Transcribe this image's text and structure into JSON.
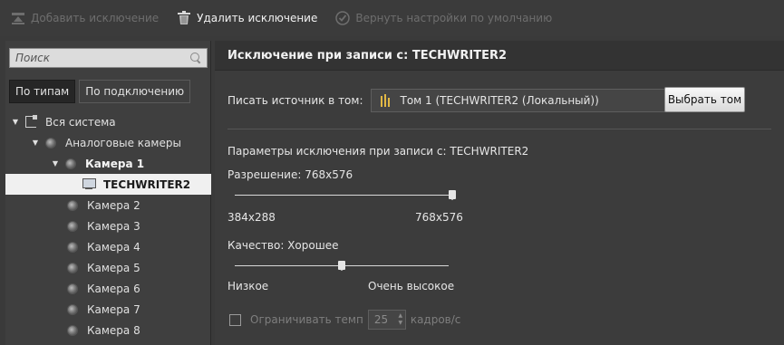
{
  "toolbar": {
    "add_label": "Добавить исключение",
    "delete_label": "Удалить исключение",
    "reset_label": "Вернуть настройки по умолчанию"
  },
  "left": {
    "search_placeholder": "Поиск",
    "tabs": [
      {
        "label": "По типам",
        "active": true
      },
      {
        "label": "По подключению",
        "active": false
      }
    ],
    "tree": [
      {
        "label": "Вся система",
        "icon": "system-icon",
        "level": 0,
        "expanded": true
      },
      {
        "label": "Аналоговые камеры",
        "icon": "camera-icon",
        "level": 1,
        "expanded": true
      },
      {
        "label": "Камера 1",
        "icon": "camera-icon",
        "level": 2,
        "expanded": true,
        "bold": true
      },
      {
        "label": "TECHWRITER2",
        "icon": "computer-icon",
        "level": 3,
        "selected": true
      },
      {
        "label": "Камера 2",
        "icon": "camera-icon",
        "level": 2
      },
      {
        "label": "Камера 3",
        "icon": "camera-icon",
        "level": 2
      },
      {
        "label": "Камера 4",
        "icon": "camera-icon",
        "level": 2
      },
      {
        "label": "Камера 5",
        "icon": "camera-icon",
        "level": 2
      },
      {
        "label": "Камера 6",
        "icon": "camera-icon",
        "level": 2
      },
      {
        "label": "Камера 7",
        "icon": "camera-icon",
        "level": 2
      },
      {
        "label": "Камера 8",
        "icon": "camera-icon",
        "level": 2
      }
    ]
  },
  "right": {
    "header": "Исключение при записи с: TECHWRITER2",
    "write_label": "Писать источник в том:",
    "volume_value": "Том 1 (TECHWRITER2 (Локальный))",
    "choose_button": "Выбрать том",
    "params_title": "Параметры исключения при записи с: TECHWRITER2",
    "resolution": {
      "label": "Разрешение: 768x576",
      "min_label": "384x288",
      "max_label": "768x576",
      "value_fraction": 1.0
    },
    "quality": {
      "label": "Качество: Хорошее",
      "min_label": "Низкое",
      "max_label": "Очень высокое",
      "value_fraction": 0.5
    },
    "limit": {
      "label": "Ограничивать темп",
      "checked": false,
      "value": "25",
      "unit": "кадров/с"
    }
  },
  "colors": {
    "background": "#3a3a3a",
    "selected_row": "#f0f0f0",
    "volume_icon": "#e2b845"
  }
}
